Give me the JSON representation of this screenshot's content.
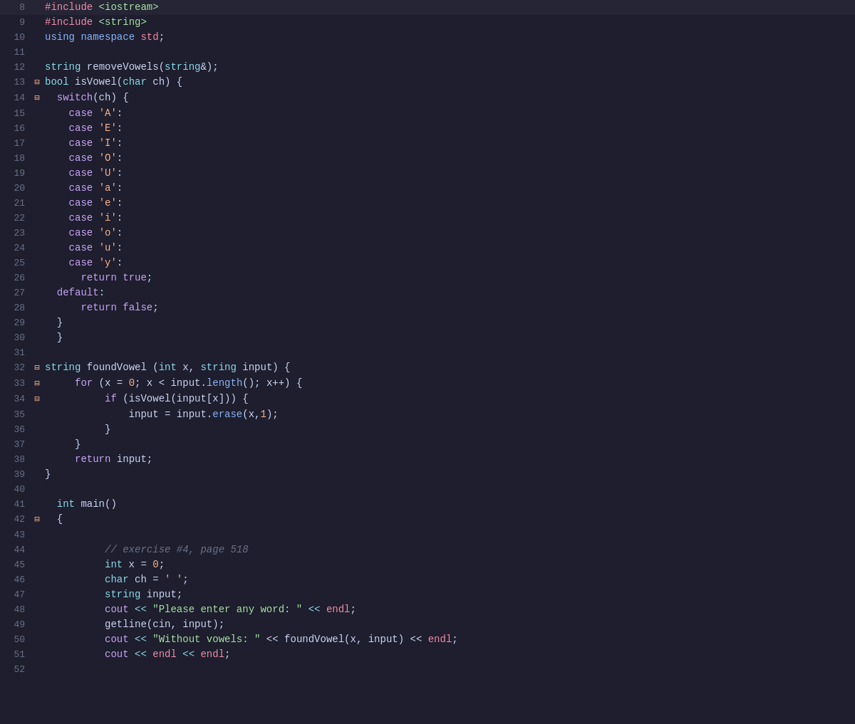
{
  "editor": {
    "lines": [
      {
        "num": "8",
        "fold": "",
        "content": [
          {
            "t": "#include",
            "c": "kw-include"
          },
          {
            "t": " <iostream>",
            "c": "str"
          }
        ]
      },
      {
        "num": "9",
        "fold": "",
        "content": [
          {
            "t": "#include",
            "c": "kw-include"
          },
          {
            "t": " <string>",
            "c": "str"
          }
        ]
      },
      {
        "num": "10",
        "fold": "",
        "content": [
          {
            "t": "using",
            "c": "kw-blue"
          },
          {
            "t": " namespace ",
            "c": "kw-blue"
          },
          {
            "t": "std",
            "c": "ns"
          },
          {
            "t": ";",
            "c": "punct"
          }
        ]
      },
      {
        "num": "11",
        "fold": "",
        "content": []
      },
      {
        "num": "12",
        "fold": "",
        "content": [
          {
            "t": "string",
            "c": "type"
          },
          {
            "t": " removeVowels(",
            "c": "ident"
          },
          {
            "t": "string",
            "c": "type"
          },
          {
            "t": "&);",
            "c": "punct"
          }
        ]
      },
      {
        "num": "13",
        "fold": "⊟",
        "content": [
          {
            "t": "bool",
            "c": "type"
          },
          {
            "t": " isVowel(",
            "c": "ident"
          },
          {
            "t": "char",
            "c": "type"
          },
          {
            "t": " ch) {",
            "c": "punct"
          }
        ]
      },
      {
        "num": "14",
        "fold": "⊟",
        "content": [
          {
            "t": "  switch",
            "c": "kw"
          },
          {
            "t": "(ch) {",
            "c": "punct"
          }
        ]
      },
      {
        "num": "15",
        "fold": "",
        "content": [
          {
            "t": "  ",
            "c": ""
          },
          {
            "t": "  case",
            "c": "kw"
          },
          {
            "t": " ",
            "c": ""
          },
          {
            "t": "'A'",
            "c": "char-lit"
          },
          {
            "t": ":",
            "c": "punct"
          }
        ]
      },
      {
        "num": "16",
        "fold": "",
        "content": [
          {
            "t": "  ",
            "c": ""
          },
          {
            "t": "  case",
            "c": "kw"
          },
          {
            "t": " ",
            "c": ""
          },
          {
            "t": "'E'",
            "c": "char-lit"
          },
          {
            "t": ":",
            "c": "punct"
          }
        ]
      },
      {
        "num": "17",
        "fold": "",
        "content": [
          {
            "t": "  ",
            "c": ""
          },
          {
            "t": "  case",
            "c": "kw"
          },
          {
            "t": " ",
            "c": ""
          },
          {
            "t": "'I'",
            "c": "char-lit"
          },
          {
            "t": ":",
            "c": "punct"
          }
        ]
      },
      {
        "num": "18",
        "fold": "",
        "content": [
          {
            "t": "  ",
            "c": ""
          },
          {
            "t": "  case",
            "c": "kw"
          },
          {
            "t": " ",
            "c": ""
          },
          {
            "t": "'O'",
            "c": "char-lit"
          },
          {
            "t": ":",
            "c": "punct"
          }
        ]
      },
      {
        "num": "19",
        "fold": "",
        "content": [
          {
            "t": "  ",
            "c": ""
          },
          {
            "t": "  case",
            "c": "kw"
          },
          {
            "t": " ",
            "c": ""
          },
          {
            "t": "'U'",
            "c": "char-lit"
          },
          {
            "t": ":",
            "c": "punct"
          }
        ]
      },
      {
        "num": "20",
        "fold": "",
        "content": [
          {
            "t": "  ",
            "c": ""
          },
          {
            "t": "  case",
            "c": "kw"
          },
          {
            "t": " ",
            "c": ""
          },
          {
            "t": "'a'",
            "c": "char-lit"
          },
          {
            "t": ":",
            "c": "punct"
          }
        ]
      },
      {
        "num": "21",
        "fold": "",
        "content": [
          {
            "t": "  ",
            "c": ""
          },
          {
            "t": "  case",
            "c": "kw"
          },
          {
            "t": " ",
            "c": ""
          },
          {
            "t": "'e'",
            "c": "char-lit"
          },
          {
            "t": ":",
            "c": "punct"
          }
        ]
      },
      {
        "num": "22",
        "fold": "",
        "content": [
          {
            "t": "  ",
            "c": ""
          },
          {
            "t": "  case",
            "c": "kw"
          },
          {
            "t": " ",
            "c": ""
          },
          {
            "t": "'i'",
            "c": "char-lit"
          },
          {
            "t": ":",
            "c": "punct"
          }
        ]
      },
      {
        "num": "23",
        "fold": "",
        "content": [
          {
            "t": "  ",
            "c": ""
          },
          {
            "t": "  case",
            "c": "kw"
          },
          {
            "t": " ",
            "c": ""
          },
          {
            "t": "'o'",
            "c": "char-lit"
          },
          {
            "t": ":",
            "c": "punct"
          }
        ]
      },
      {
        "num": "24",
        "fold": "",
        "content": [
          {
            "t": "  ",
            "c": ""
          },
          {
            "t": "  case",
            "c": "kw"
          },
          {
            "t": " ",
            "c": ""
          },
          {
            "t": "'u'",
            "c": "char-lit"
          },
          {
            "t": ":",
            "c": "punct"
          }
        ]
      },
      {
        "num": "25",
        "fold": "",
        "content": [
          {
            "t": "  ",
            "c": ""
          },
          {
            "t": "  case",
            "c": "kw"
          },
          {
            "t": " ",
            "c": ""
          },
          {
            "t": "'y'",
            "c": "char-lit"
          },
          {
            "t": ":",
            "c": "punct"
          }
        ]
      },
      {
        "num": "26",
        "fold": "",
        "content": [
          {
            "t": "      return",
            "c": "kw"
          },
          {
            "t": " ",
            "c": ""
          },
          {
            "t": "true",
            "c": "kw"
          },
          {
            "t": ";",
            "c": "punct"
          }
        ]
      },
      {
        "num": "27",
        "fold": "",
        "content": [
          {
            "t": "  default",
            "c": "kw"
          },
          {
            "t": ":",
            "c": "punct"
          }
        ]
      },
      {
        "num": "28",
        "fold": "",
        "content": [
          {
            "t": "      return",
            "c": "kw"
          },
          {
            "t": " ",
            "c": ""
          },
          {
            "t": "false",
            "c": "kw"
          },
          {
            "t": ";",
            "c": "punct"
          }
        ]
      },
      {
        "num": "29",
        "fold": "",
        "content": [
          {
            "t": "  }",
            "c": "punct"
          }
        ]
      },
      {
        "num": "30",
        "fold": "",
        "content": [
          {
            "t": "  }",
            "c": "punct"
          }
        ]
      },
      {
        "num": "31",
        "fold": "",
        "content": []
      },
      {
        "num": "32",
        "fold": "⊟",
        "content": [
          {
            "t": "string",
            "c": "type"
          },
          {
            "t": " foundVowel (",
            "c": "ident"
          },
          {
            "t": "int",
            "c": "type"
          },
          {
            "t": " x, ",
            "c": "punct"
          },
          {
            "t": "string",
            "c": "type"
          },
          {
            "t": " input) {",
            "c": "punct"
          }
        ]
      },
      {
        "num": "33",
        "fold": "⊟",
        "content": [
          {
            "t": "     for",
            "c": "kw"
          },
          {
            "t": " (x = ",
            "c": "punct"
          },
          {
            "t": "0",
            "c": "num"
          },
          {
            "t": "; x < input.",
            "c": "punct"
          },
          {
            "t": "length",
            "c": "method"
          },
          {
            "t": "(); x++) {",
            "c": "punct"
          }
        ]
      },
      {
        "num": "34",
        "fold": "⊟",
        "content": [
          {
            "t": "          if",
            "c": "kw"
          },
          {
            "t": " (isVowel(input[x])) {",
            "c": "punct"
          }
        ]
      },
      {
        "num": "35",
        "fold": "",
        "content": [
          {
            "t": "              input = input.",
            "c": "ident"
          },
          {
            "t": "erase",
            "c": "method"
          },
          {
            "t": "(x,",
            "c": "punct"
          },
          {
            "t": "1",
            "c": "num"
          },
          {
            "t": ");",
            "c": "punct"
          }
        ]
      },
      {
        "num": "36",
        "fold": "",
        "content": [
          {
            "t": "          }",
            "c": "punct"
          }
        ]
      },
      {
        "num": "37",
        "fold": "",
        "content": [
          {
            "t": "     }",
            "c": "punct"
          }
        ]
      },
      {
        "num": "38",
        "fold": "",
        "content": [
          {
            "t": "     return",
            "c": "kw"
          },
          {
            "t": " input;",
            "c": "punct"
          }
        ]
      },
      {
        "num": "39",
        "fold": "",
        "content": [
          {
            "t": "}",
            "c": "punct"
          }
        ]
      },
      {
        "num": "40",
        "fold": "",
        "content": []
      },
      {
        "num": "41",
        "fold": "",
        "content": [
          {
            "t": "  int",
            "c": "type"
          },
          {
            "t": " main()",
            "c": "ident"
          }
        ]
      },
      {
        "num": "42",
        "fold": "⊟",
        "content": [
          {
            "t": "  {",
            "c": "punct"
          }
        ]
      },
      {
        "num": "43",
        "fold": "",
        "content": []
      },
      {
        "num": "44",
        "fold": "",
        "content": [
          {
            "t": "          ",
            "c": ""
          },
          {
            "t": "// exercise #4, page 518",
            "c": "comment"
          }
        ]
      },
      {
        "num": "45",
        "fold": "",
        "content": [
          {
            "t": "          int",
            "c": "type"
          },
          {
            "t": " x = ",
            "c": "punct"
          },
          {
            "t": "0",
            "c": "num"
          },
          {
            "t": ";",
            "c": "punct"
          }
        ]
      },
      {
        "num": "46",
        "fold": "",
        "content": [
          {
            "t": "          char",
            "c": "type"
          },
          {
            "t": " ch = ",
            "c": "punct"
          },
          {
            "t": "' '",
            "c": "char-lit"
          },
          {
            "t": ";",
            "c": "punct"
          }
        ]
      },
      {
        "num": "47",
        "fold": "",
        "content": [
          {
            "t": "          string",
            "c": "type"
          },
          {
            "t": " input;",
            "c": "ident"
          }
        ]
      },
      {
        "num": "48",
        "fold": "",
        "content": [
          {
            "t": "          cout",
            "c": "kw"
          },
          {
            "t": " << ",
            "c": "op"
          },
          {
            "t": "\"Please enter any word: \"",
            "c": "str"
          },
          {
            "t": " << ",
            "c": "op"
          },
          {
            "t": "endl",
            "c": "endl-kw"
          },
          {
            "t": ";",
            "c": "punct"
          }
        ]
      },
      {
        "num": "49",
        "fold": "",
        "content": [
          {
            "t": "          getline(cin, input);",
            "c": "ident"
          }
        ]
      },
      {
        "num": "50",
        "fold": "",
        "content": [
          {
            "t": "          cout",
            "c": "kw"
          },
          {
            "t": " << ",
            "c": "op"
          },
          {
            "t": "\"Without vowels: \"",
            "c": "str"
          },
          {
            "t": " << foundVowel(x, input) << ",
            "c": "punct"
          },
          {
            "t": "endl",
            "c": "endl-kw"
          },
          {
            "t": ";",
            "c": "punct"
          }
        ]
      },
      {
        "num": "51",
        "fold": "",
        "content": [
          {
            "t": "          cout",
            "c": "kw"
          },
          {
            "t": " << ",
            "c": "op"
          },
          {
            "t": "endl",
            "c": "endl-kw"
          },
          {
            "t": " << ",
            "c": "op"
          },
          {
            "t": "endl",
            "c": "endl-kw"
          },
          {
            "t": ";",
            "c": "punct"
          }
        ]
      },
      {
        "num": "52",
        "fold": "",
        "content": []
      }
    ]
  }
}
